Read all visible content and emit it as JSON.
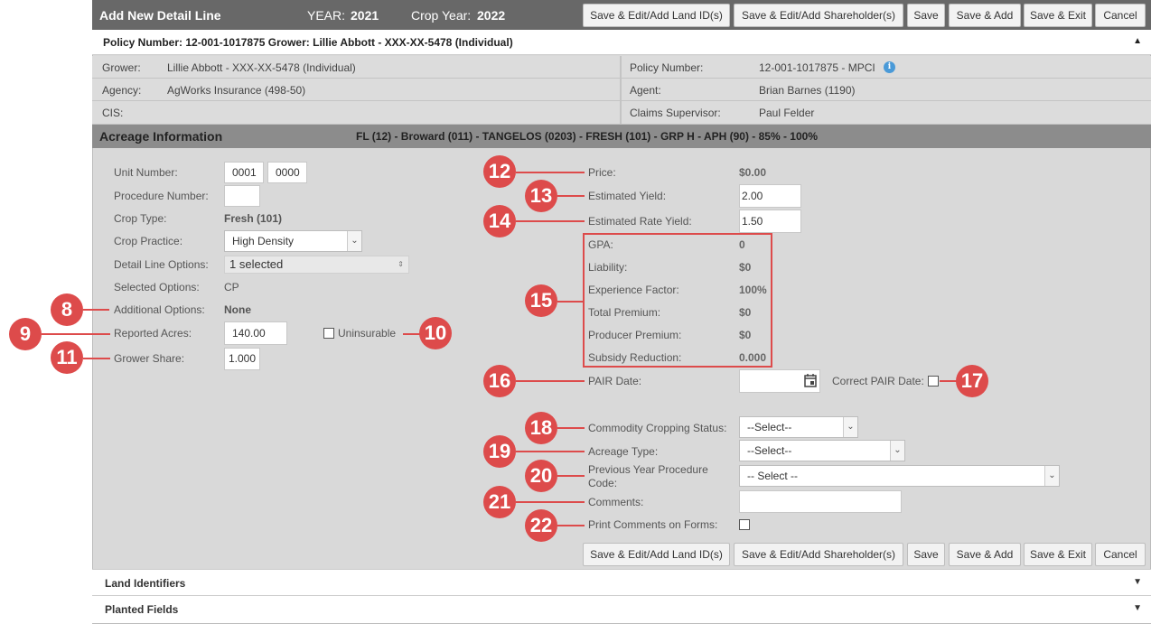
{
  "header": {
    "title": "Add New Detail Line",
    "year_label": "YEAR:",
    "year_value": "2021",
    "crop_year_label": "Crop Year:",
    "crop_year_value": "2022"
  },
  "toolbar": {
    "land_ids": "Save & Edit/Add Land ID(s)",
    "shareholders": "Save & Edit/Add Shareholder(s)",
    "save": "Save",
    "save_add": "Save & Add",
    "save_exit": "Save & Exit",
    "cancel": "Cancel"
  },
  "policy_bar": {
    "text": "Policy Number: 12-001-1017875 Grower: Lillie Abbott - XXX-XX-5478 (Individual)"
  },
  "info": {
    "grower_label": "Grower:",
    "grower_value": "Lillie Abbott - XXX-XX-5478 (Individual)",
    "agency_label": "Agency:",
    "agency_value": "AgWorks Insurance (498-50)",
    "cis_label": "CIS:",
    "policy_label": "Policy Number:",
    "policy_value": "12-001-1017875 - MPCI",
    "agent_label": "Agent:",
    "agent_value": "Brian Barnes (1190)",
    "claims_label": "Claims Supervisor:",
    "claims_value": "Paul Felder"
  },
  "acreage": {
    "title": "Acreage Information",
    "summary": "FL (12) - Broward (011) - TANGELOS (0203) - FRESH (101) - GRP H - APH (90) - 85% - 100%"
  },
  "left_form": {
    "unit_number_label": "Unit Number:",
    "unit_number_1": "0001",
    "unit_number_2": "0000",
    "procedure_number_label": "Procedure Number:",
    "crop_type_label": "Crop Type:",
    "crop_type_value": "Fresh (101)",
    "crop_practice_label": "Crop Practice:",
    "crop_practice_value": "High Density",
    "detail_line_options_label": "Detail Line Options:",
    "detail_line_options_value": "1 selected",
    "selected_options_label": "Selected Options:",
    "selected_options_value": "CP",
    "additional_options_label": "Additional Options:",
    "additional_options_value": "None",
    "reported_acres_label": "Reported Acres:",
    "reported_acres_value": "140.00",
    "uninsurable_label": "Uninsurable",
    "grower_share_label": "Grower Share:",
    "grower_share_value": "1.000"
  },
  "right_form": {
    "price_label": "Price:",
    "price_value": "$0.00",
    "estimated_yield_label": "Estimated Yield:",
    "estimated_yield_value": "2.00",
    "estimated_rate_yield_label": "Estimated Rate Yield:",
    "estimated_rate_yield_value": "1.50",
    "gpa_label": "GPA:",
    "gpa_value": "0",
    "liability_label": "Liability:",
    "liability_value": "$0",
    "experience_factor_label": "Experience Factor:",
    "experience_factor_value": "100%",
    "total_premium_label": "Total Premium:",
    "total_premium_value": "$0",
    "producer_premium_label": "Producer Premium:",
    "producer_premium_value": "$0",
    "subsidy_reduction_label": "Subsidy Reduction:",
    "subsidy_reduction_value": "0.000",
    "pair_date_label": "PAIR Date:",
    "correct_pair_date_label": "Correct PAIR Date:",
    "commodity_label": "Commodity Cropping Status:",
    "commodity_value": "--Select--",
    "acreage_type_label": "Acreage Type:",
    "acreage_type_value": "--Select--",
    "prev_year_label_1": "Previous Year Procedure",
    "prev_year_label_2": "Code:",
    "prev_year_value": "-- Select --",
    "comments_label": "Comments:",
    "print_comments_label": "Print Comments on Forms:"
  },
  "callouts": [
    "8",
    "9",
    "10",
    "11",
    "12",
    "13",
    "14",
    "15",
    "16",
    "17",
    "18",
    "19",
    "20",
    "21",
    "22"
  ],
  "sections": {
    "land_identifiers": "Land Identifiers",
    "planted_fields": "Planted Fields"
  },
  "colors": {
    "title_bar": "#686868",
    "section_bar": "#8c8c8c",
    "panel": "#d9d9d9",
    "callout": "#dd4b4b"
  },
  "icons": {
    "collapse": "triangle-up-icon",
    "expand": "triangle-down-icon",
    "info": "info-icon",
    "calendar": "calendar-icon",
    "dropdown": "chevron-down-icon"
  }
}
